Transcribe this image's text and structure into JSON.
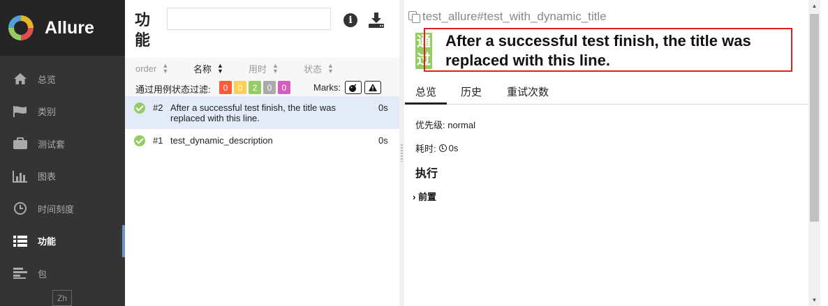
{
  "sidebar": {
    "brand": "Allure",
    "items": [
      {
        "label": "总览",
        "icon": "home-icon"
      },
      {
        "label": "类别",
        "icon": "flag-icon"
      },
      {
        "label": "测试套",
        "icon": "briefcase-icon"
      },
      {
        "label": "图表",
        "icon": "bar-chart-icon"
      },
      {
        "label": "时间刻度",
        "icon": "clock-icon"
      },
      {
        "label": "功能",
        "icon": "list-icon",
        "active": true
      },
      {
        "label": "包",
        "icon": "align-left-icon"
      }
    ],
    "language": "Zh"
  },
  "middle": {
    "title": "功能",
    "search_placeholder": "",
    "sort": {
      "order": "order",
      "name": "名称",
      "duration": "用时",
      "status": "状态"
    },
    "filter_label": "通过用例状态过滤:",
    "status_counts": [
      {
        "value": "0",
        "color": "#fd5a3e"
      },
      {
        "value": "0",
        "color": "#ffd050"
      },
      {
        "value": "2",
        "color": "#97cc64"
      },
      {
        "value": "0",
        "color": "#aaaaaa"
      },
      {
        "value": "0",
        "color": "#d35ebe"
      }
    ],
    "marks_label": "Marks:",
    "rows": [
      {
        "num": "#2",
        "title": "After a successful test finish, the title was replaced with this line.",
        "duration": "0s",
        "status": "passed"
      },
      {
        "num": "#1",
        "title": "test_dynamic_description",
        "duration": "0s",
        "status": "passed"
      }
    ]
  },
  "detail": {
    "breadcrumb": "test_allure#test_with_dynamic_title",
    "status_tag": "通过",
    "title": "After a successful test finish, the title was replaced with this line.",
    "tabs": [
      "总览",
      "历史",
      "重试次数"
    ],
    "priority": "优先级: normal",
    "duration_label": "耗时:",
    "duration_value": "0s",
    "execution_heading": "执行",
    "setup_label": "前置"
  }
}
